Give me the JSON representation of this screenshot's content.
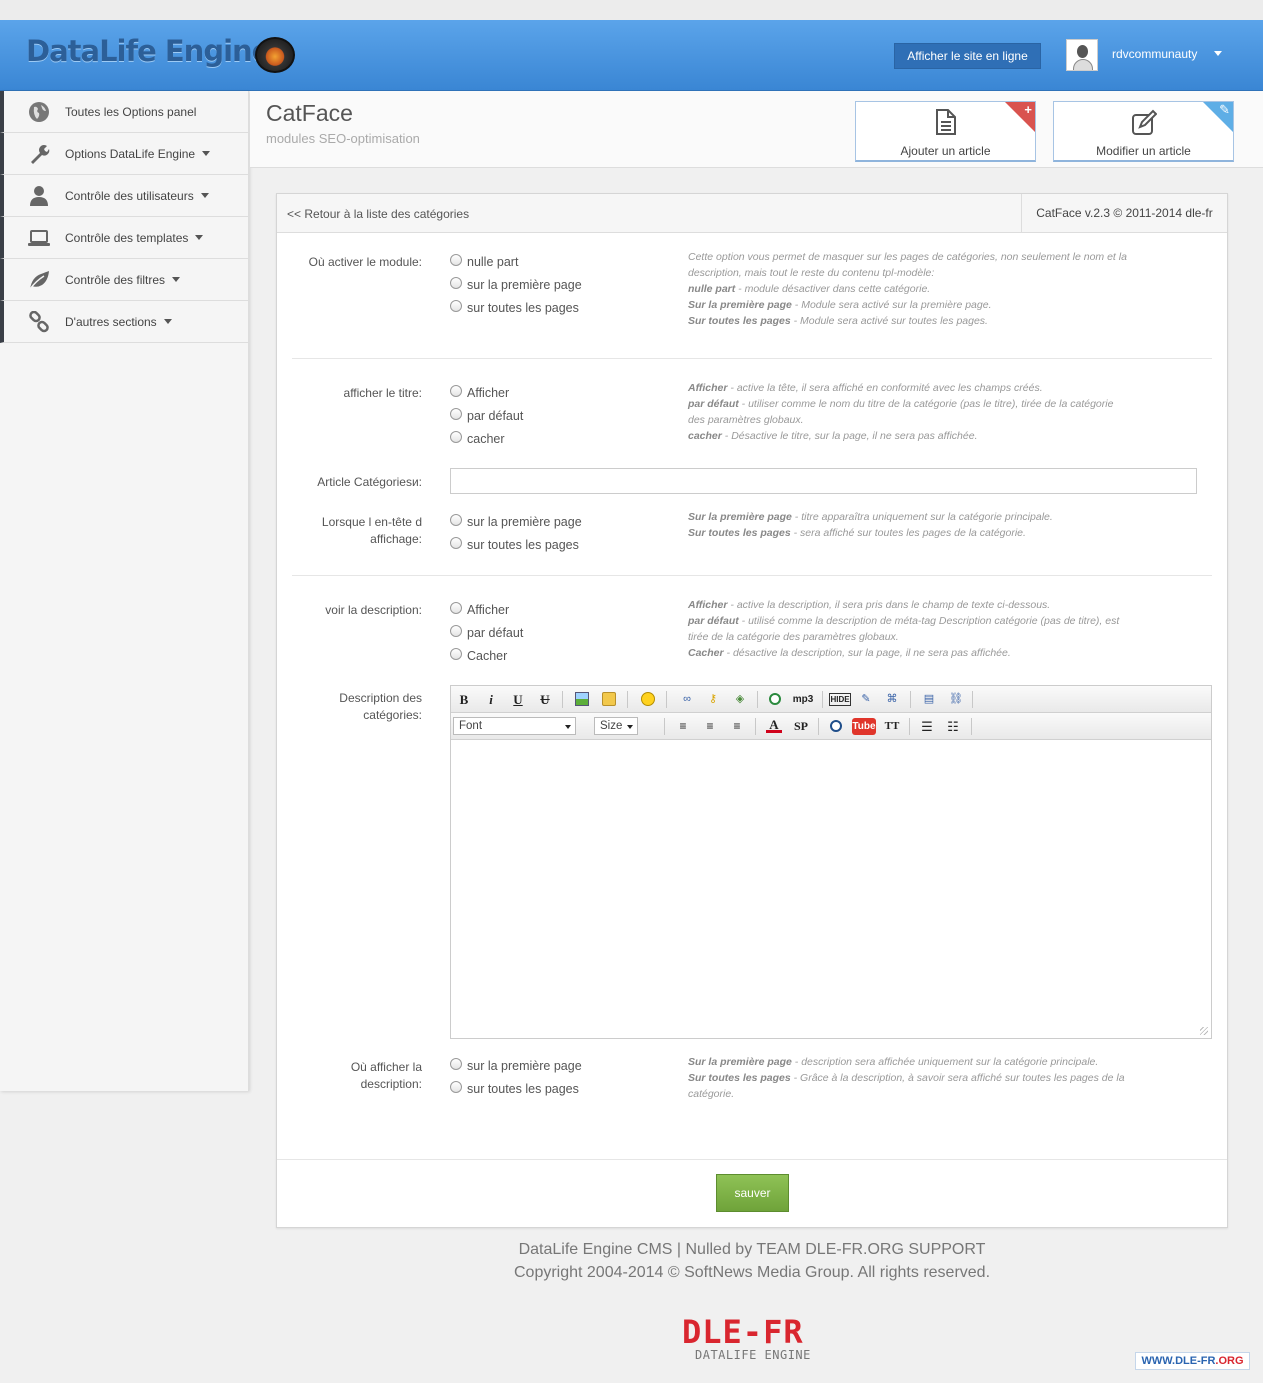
{
  "header": {
    "logo_text": "DataLife Engine",
    "view_site_label": "Afficher le site en ligne",
    "username": "rdvcommunauty"
  },
  "sidebar": {
    "items": [
      {
        "label": "Toutes les Options panel",
        "icon": "globe-icon",
        "has_caret": false
      },
      {
        "label": "Options DataLife Engine",
        "icon": "wrench-icon",
        "has_caret": true
      },
      {
        "label": "Contrôle des utilisateurs",
        "icon": "user-icon",
        "has_caret": true
      },
      {
        "label": "Contrôle des templates",
        "icon": "laptop-icon",
        "has_caret": true
      },
      {
        "label": "Contrôle des filtres",
        "icon": "leaf-icon",
        "has_caret": true
      },
      {
        "label": "D'autres sections",
        "icon": "link-icon",
        "has_caret": true
      }
    ]
  },
  "page": {
    "title": "CatFace",
    "subtitle": "modules SEO-optimisation",
    "add_article_label": "Ajouter un article",
    "edit_article_label": "Modifier un article"
  },
  "panel": {
    "back_link": "<< Retour à la liste des catégories",
    "version": "CatFace v.2.3 © 2011-2014 dle-fr"
  },
  "form": {
    "activate": {
      "label": "Où activer le module:",
      "options": [
        "nulle part",
        "sur la première page",
        "sur toutes les pages"
      ],
      "help_intro": "Cette option vous permet de masquer sur les pages de catégories, non seulement le nom et la description, mais tout le reste du contenu tpl-modèle:",
      "help_1b": "nulle part",
      "help_1": " - module désactiver dans cette catégorie.",
      "help_2b": "Sur la première page",
      "help_2": " - Module sera activé sur la première page.",
      "help_3b": "Sur toutes les pages",
      "help_3": " - Module sera activé sur toutes les pages."
    },
    "title_display": {
      "label": "afficher le titre:",
      "options": [
        "Afficher",
        "par défaut",
        "cacher"
      ],
      "help_1b": "Afficher",
      "help_1": " - active la tête, il sera affiché en conformité avec les champs créés.",
      "help_2b": "par défaut",
      "help_2": " - utiliser comme le nom du titre de la catégorie (pas le titre), tirée de la catégorie des paramètres globaux.",
      "help_3b": "cacher",
      "help_3": " - Désactive le titre, sur la page, il ne sera pas affichée."
    },
    "article_categories": {
      "label": "Article Catégoriesи:",
      "value": ""
    },
    "header_display": {
      "label": "Lorsque l en-tête d affichage:",
      "options": [
        "sur la première page",
        "sur toutes les pages"
      ],
      "help_1b": "Sur la première page",
      "help_1": " - titre apparaîtra uniquement sur la catégorie principale.",
      "help_2b": "Sur toutes les pages",
      "help_2": " - sera affiché sur toutes les pages de la catégorie."
    },
    "description_display": {
      "label": "voir la description:",
      "options": [
        "Afficher",
        "par défaut",
        "Cacher"
      ],
      "help_1b": "Afficher",
      "help_1": " - active la description, il sera pris dans le champ de texte ci-dessous.",
      "help_2b": "par défaut",
      "help_2": " - utilisé comme la description de méta-tag Description catégorie (pas de titre), est tirée de la catégorie des paramètres globaux.",
      "help_3b": "Cacher",
      "help_3": " - désactive la description, sur la page, il ne sera pas affichée."
    },
    "description_editor": {
      "label": "Description des catégories:",
      "font_select": "Font",
      "size_select": "Size",
      "mp3_label": "mp3",
      "hide_label": "HIDE",
      "sp_label": "SP",
      "tt_label": "TT",
      "tube_label": "Tube",
      "content": ""
    },
    "description_where": {
      "label": "Où afficher la description:",
      "options": [
        "sur la première page",
        "sur toutes les pages"
      ],
      "help_1b": "Sur la première page",
      "help_1": " - description sera affichée uniquement sur la catégorie principale.",
      "help_2b": "Sur toutes les pages",
      "help_2": " - Grâce à la description, à savoir sera affiché sur toutes les pages de la catégorie."
    },
    "save_label": "sauver"
  },
  "footer": {
    "line1": "DataLife Engine CMS | Nulled by TEAM DLE-FR.ORG SUPPORT",
    "line2": "Copyright 2004-2014 © SoftNews Media Group. All rights reserved.",
    "logo_text": "DLE-FR",
    "logo_sub": "DATALIFE ENGINE",
    "watermark_a": "WWW.DLE-FR",
    "watermark_b": ".ORG"
  }
}
